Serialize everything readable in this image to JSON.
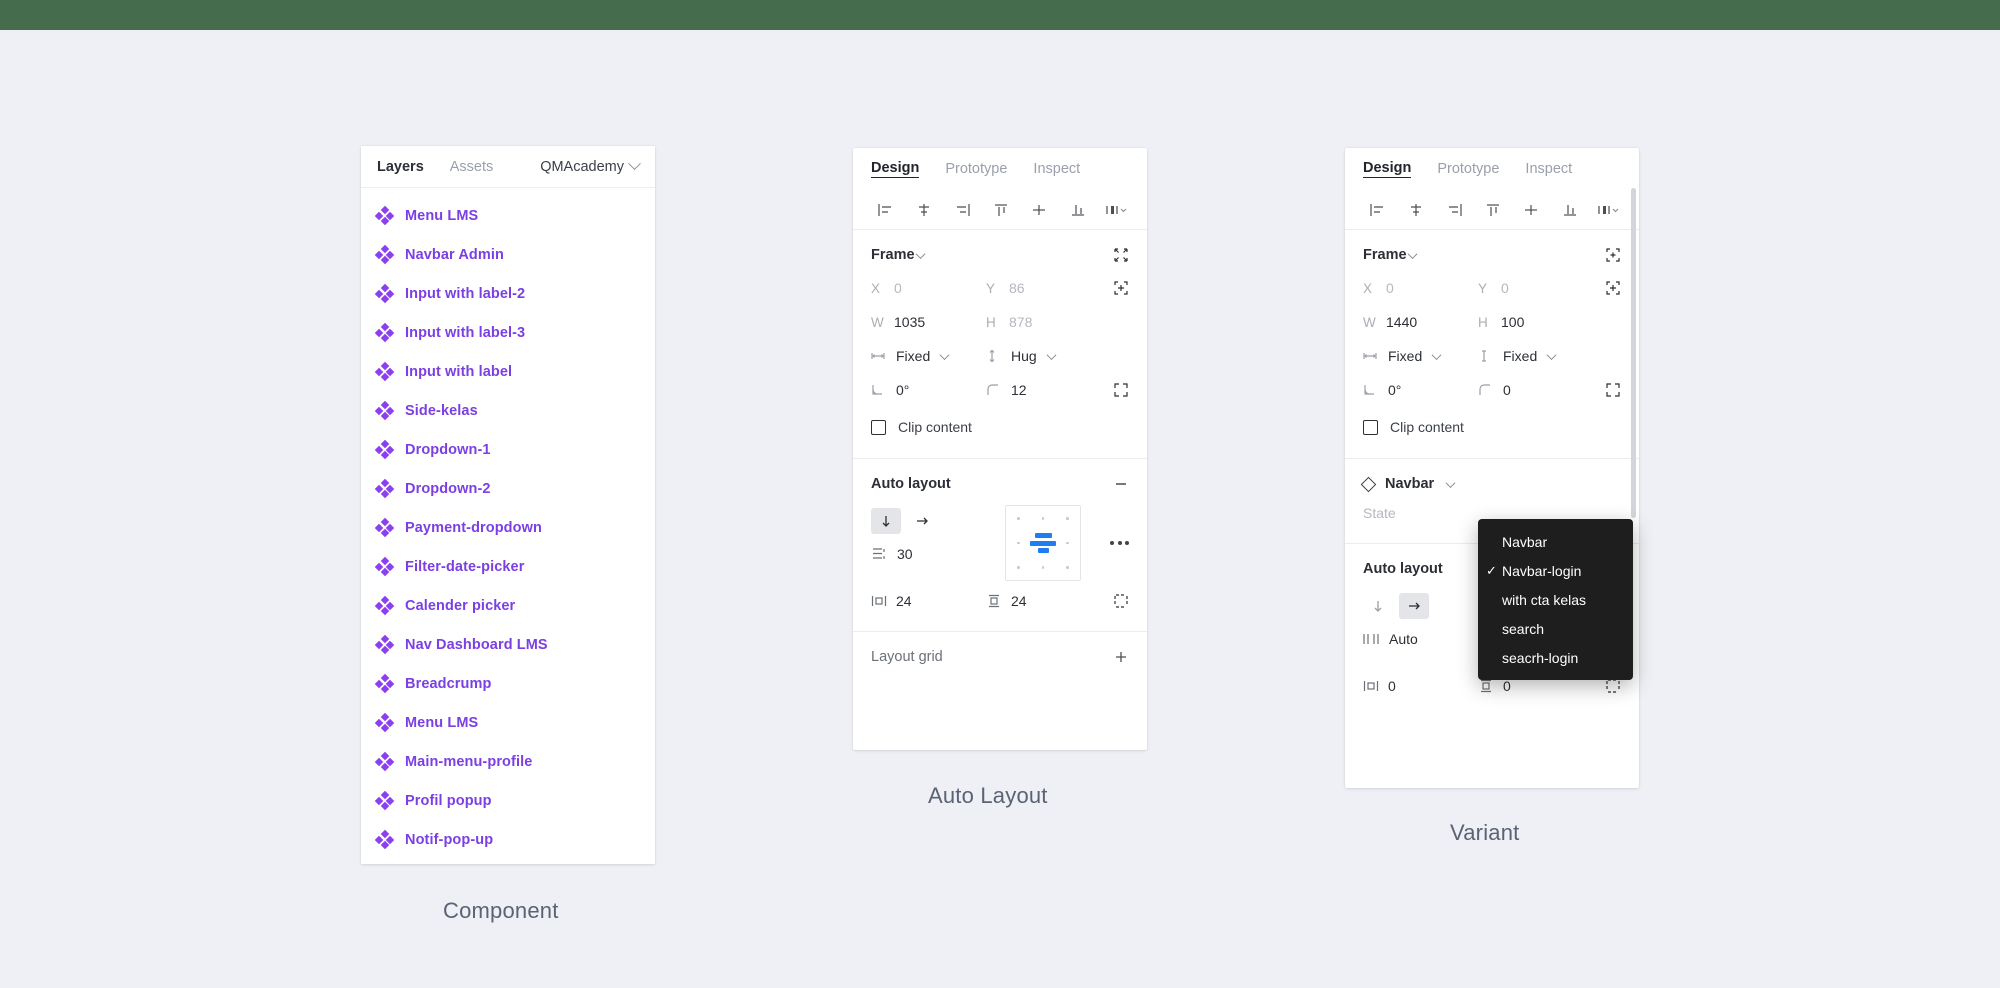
{
  "topbar": {
    "color": "#456d4d"
  },
  "captions": {
    "component": "Component",
    "auto_layout": "Auto Layout",
    "variant": "Variant"
  },
  "layers_panel": {
    "tabs": [
      {
        "label": "Layers",
        "active": true
      },
      {
        "label": "Assets",
        "active": false
      }
    ],
    "page_name": "QMAcademy",
    "items": [
      {
        "label": "Menu LMS",
        "icon": "component-icon"
      },
      {
        "label": "Navbar Admin",
        "icon": "component-icon"
      },
      {
        "label": "Input with label-2",
        "icon": "component-icon"
      },
      {
        "label": "Input with label-3",
        "icon": "component-icon"
      },
      {
        "label": "Input with label",
        "icon": "component-icon"
      },
      {
        "label": "Side-kelas",
        "icon": "component-icon"
      },
      {
        "label": "Dropdown-1",
        "icon": "component-icon"
      },
      {
        "label": "Dropdown-2",
        "icon": "component-icon"
      },
      {
        "label": "Payment-dropdown",
        "icon": "component-icon"
      },
      {
        "label": "Filter-date-picker",
        "icon": "component-icon"
      },
      {
        "label": "Calender picker",
        "icon": "component-icon"
      },
      {
        "label": "Nav Dashboard LMS",
        "icon": "component-icon"
      },
      {
        "label": "Breadcrump",
        "icon": "component-icon"
      },
      {
        "label": "Menu LMS",
        "icon": "component-icon"
      },
      {
        "label": "Main-menu-profile",
        "icon": "component-icon"
      },
      {
        "label": "Profil popup",
        "icon": "component-icon"
      },
      {
        "label": "Notif-pop-up",
        "icon": "component-icon"
      }
    ]
  },
  "autolayout_panel": {
    "tabs": [
      {
        "label": "Design",
        "active": true
      },
      {
        "label": "Prototype",
        "active": false
      },
      {
        "label": "Inspect",
        "active": false
      }
    ],
    "align_icons": [
      "align-left-icon",
      "align-horizontal-centers-icon",
      "align-right-icon",
      "align-top-icon",
      "align-vertical-centers-icon",
      "align-bottom-icon",
      "distribute-icon"
    ],
    "frame": {
      "title": "Frame",
      "x_label": "X",
      "x_value": "0",
      "y_label": "Y",
      "y_value": "86",
      "w_label": "W",
      "w_value": "1035",
      "h_label": "H",
      "h_value": "878",
      "horizontal_resizing": "Fixed",
      "vertical_resizing": "Hug",
      "rotation": "0°",
      "corner_radius": "12",
      "clip_content_label": "Clip content",
      "clip_content_checked": false
    },
    "auto_layout": {
      "title": "Auto layout",
      "direction": "vertical",
      "gap": "30",
      "padding_horizontal": "24",
      "padding_vertical": "24"
    },
    "layout_grid": {
      "title": "Layout grid",
      "add_label": "+"
    }
  },
  "variant_panel": {
    "tabs": [
      {
        "label": "Design",
        "active": true
      },
      {
        "label": "Prototype",
        "active": false
      },
      {
        "label": "Inspect",
        "active": false
      }
    ],
    "frame": {
      "title": "Frame",
      "x_label": "X",
      "x_value": "0",
      "y_label": "Y",
      "y_value": "0",
      "w_label": "W",
      "w_value": "1440",
      "h_label": "H",
      "h_value": "100",
      "horizontal_resizing": "Fixed",
      "vertical_resizing": "Fixed",
      "rotation": "0°",
      "corner_radius": "0",
      "clip_content_label": "Clip content",
      "clip_content_checked": false
    },
    "component": {
      "name": "Navbar",
      "property_label": "State"
    },
    "auto_layout": {
      "title": "Auto layout",
      "direction": "horizontal",
      "gap": "Auto",
      "padding_horizontal": "0",
      "padding_vertical": "0"
    },
    "dropdown": {
      "options": [
        {
          "label": "Navbar",
          "checked": false
        },
        {
          "label": "Navbar-login",
          "checked": true
        },
        {
          "label": "with cta kelas",
          "checked": false
        },
        {
          "label": "search",
          "checked": false
        },
        {
          "label": "seacrh-login",
          "checked": false
        }
      ],
      "check_glyph": "✓"
    }
  }
}
